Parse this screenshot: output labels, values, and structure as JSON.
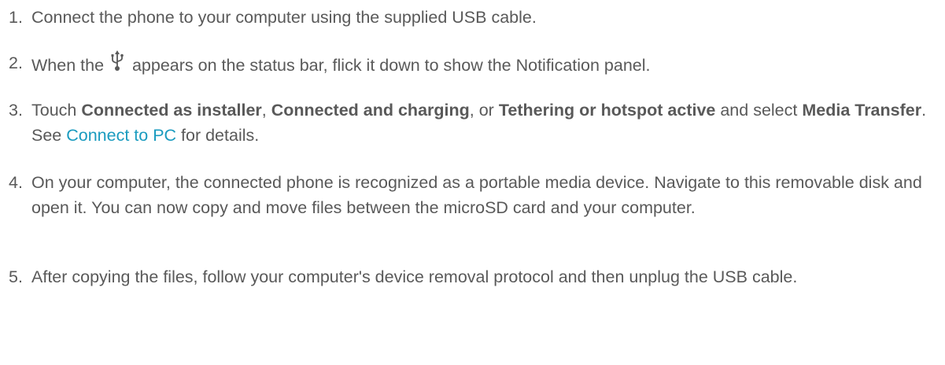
{
  "steps": [
    {
      "number": "1.",
      "text": "Connect the phone to your computer using the supplied USB cable."
    },
    {
      "number": "2.",
      "before": "When the",
      "icon": "usb-icon",
      "after": "appears on the status bar, flick it down to show the Notification panel."
    },
    {
      "number": "3.",
      "t1": "Touch ",
      "b1": "Connected as installer",
      "t2": ", ",
      "b2": "Connected and charging",
      "t3": ", or ",
      "b3": "Tethering or hotspot active",
      "t4": " and select ",
      "b4": "Media Transfer",
      "t5": ". See ",
      "link": "Connect to PC",
      "t6": " for details."
    },
    {
      "number": "4.",
      "text": "On your computer, the connected phone is recognized as a portable media device. Navigate to this removable disk and open it. You can now copy and move files between the microSD card and your computer."
    },
    {
      "number": "5.",
      "text": "After copying the files, follow your computer's device removal protocol and then unplug the USB cable."
    }
  ],
  "colors": {
    "text": "#595959",
    "link": "#1a9bbf"
  }
}
